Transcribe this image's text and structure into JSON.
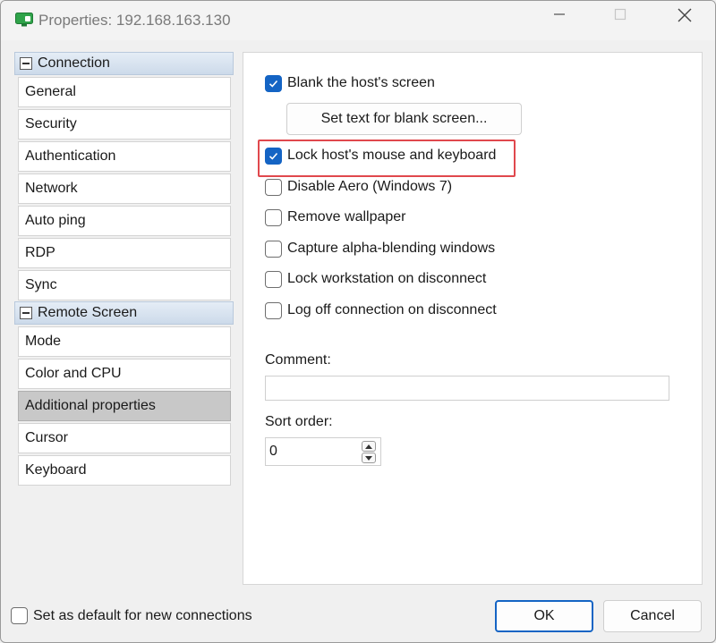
{
  "window": {
    "title": "Properties: 192.168.163.130",
    "app_icon": "monitor-icon",
    "accent_color": "#1464c4",
    "highlight_color": "#e0484d"
  },
  "sidebar": {
    "groups": [
      {
        "label": "Connection",
        "items": [
          "General",
          "Security",
          "Authentication",
          "Network",
          "Auto ping",
          "RDP",
          "Sync"
        ]
      },
      {
        "label": "Remote Screen",
        "items": [
          "Mode",
          "Color and CPU",
          "Additional properties",
          "Cursor",
          "Keyboard"
        ]
      }
    ],
    "selected": "Additional properties"
  },
  "panel": {
    "blank_screen": {
      "label": "Blank the host's screen",
      "checked": true
    },
    "set_text_button": "Set text for blank screen...",
    "lock_mouse": {
      "label": "Lock host's mouse and keyboard",
      "checked": true
    },
    "disable_aero": {
      "label": "Disable Aero (Windows 7)",
      "checked": false
    },
    "remove_wallpaper": {
      "label": "Remove wallpaper",
      "checked": false
    },
    "capture_alpha": {
      "label": "Capture alpha-blending windows",
      "checked": false
    },
    "lock_workstation": {
      "label": "Lock workstation on disconnect",
      "checked": false
    },
    "log_off": {
      "label": "Log off connection on disconnect",
      "checked": false
    },
    "comment": {
      "label": "Comment:",
      "value": ""
    },
    "sort_order": {
      "label": "Sort order:",
      "value": "0"
    }
  },
  "footer": {
    "default_checkbox": {
      "label": "Set as default for new connections",
      "checked": false
    },
    "ok_label": "OK",
    "cancel_label": "Cancel"
  }
}
